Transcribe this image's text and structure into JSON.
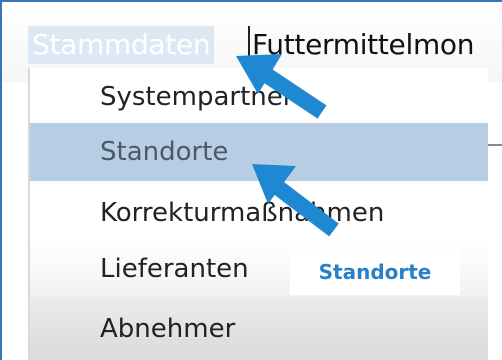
{
  "menubar": {
    "tabs": [
      {
        "label": "Stammdaten"
      },
      {
        "label": "Futtermittelmon"
      }
    ]
  },
  "dropdown": {
    "items": [
      {
        "label": "Systempartner"
      },
      {
        "label": "Standorte",
        "selected": true
      },
      {
        "label": "Korrekturmaßnahmen"
      },
      {
        "label": "Lieferanten"
      },
      {
        "label": "Abnehmer"
      }
    ]
  },
  "annotation": {
    "callout_text": "Standorte",
    "color": "#2a7fc6"
  },
  "colors": {
    "frame": "#3b73b9",
    "active_tab_bg": "#dde8f4",
    "selected_item_bg": "#b6cde3",
    "arrow": "#1e88d2"
  }
}
